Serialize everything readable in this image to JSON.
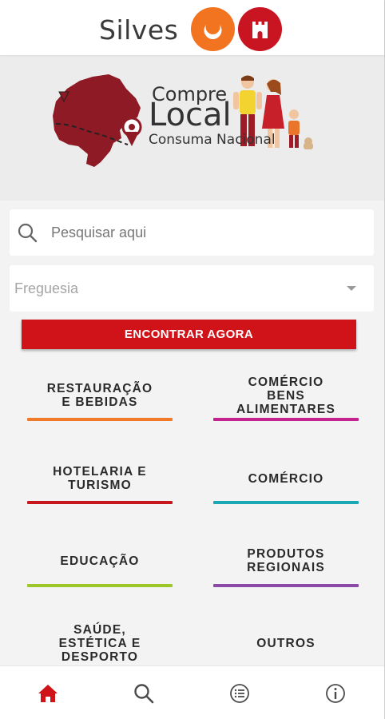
{
  "header": {
    "brand": "Silves",
    "colors": {
      "orange": "#f27420",
      "red": "#c81521"
    }
  },
  "banner": {
    "line1": "Compre",
    "line2": "Local",
    "line3": "Consuma Nacional"
  },
  "search": {
    "placeholder": "Pesquisar aqui"
  },
  "filter": {
    "placeholder": "Freguesia"
  },
  "find_button": {
    "label": "ENCONTRAR AGORA"
  },
  "categories": [
    {
      "label": "RESTAURAÇÃO\nE BEBIDAS",
      "color": "#f07a29"
    },
    {
      "label": "COMÉRCIO\nBENS\nALIMENTARES",
      "color": "#c2238f"
    },
    {
      "label": "HOTELARIA E\nTURISMO",
      "color": "#c8161d"
    },
    {
      "label": "COMÉRCIO",
      "color": "#1aa8b5"
    },
    {
      "label": "EDUCAÇÃO",
      "color": "#9bc828"
    },
    {
      "label": "PRODUTOS\nREGIONAIS",
      "color": "#8c4aa8"
    },
    {
      "label": "SAÚDE,\nESTÉTICA E\nDESPORTO",
      "color": "#d01219"
    },
    {
      "label": "OUTROS",
      "color": "#888888"
    }
  ],
  "nav": {
    "items": [
      {
        "icon": "home-icon",
        "active": true
      },
      {
        "icon": "search-icon",
        "active": false
      },
      {
        "icon": "list-icon",
        "active": false
      },
      {
        "icon": "info-icon",
        "active": false
      }
    ],
    "active_color": "#d01219",
    "inactive_color": "#4a4a4a"
  }
}
